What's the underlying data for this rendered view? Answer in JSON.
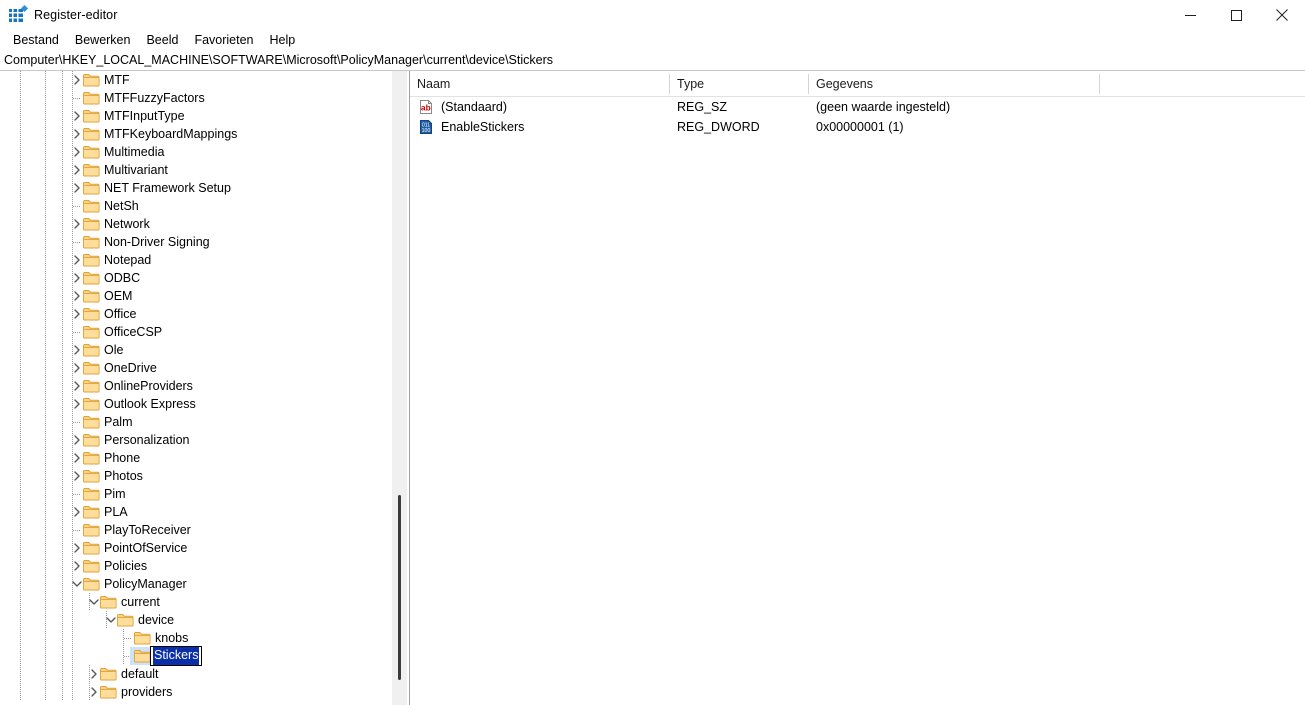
{
  "window": {
    "title": "Register-editor",
    "icon": "registry-editor-icon",
    "controls": {
      "minimize": "minimize-icon",
      "maximize": "maximize-icon",
      "close": "close-icon"
    }
  },
  "menubar": {
    "items": [
      {
        "label": "Bestand"
      },
      {
        "label": "Bewerken"
      },
      {
        "label": "Beeld"
      },
      {
        "label": "Favorieten"
      },
      {
        "label": "Help"
      }
    ]
  },
  "addressbar": {
    "path": "Computer\\HKEY_LOCAL_MACHINE\\SOFTWARE\\Microsoft\\PolicyManager\\current\\device\\Stickers"
  },
  "tree": {
    "scrollbar": {
      "thumb_top_pct": 67,
      "thumb_height_pct": 29
    },
    "nodes": [
      {
        "label": "MTF",
        "depth": 0,
        "expander": "collapsed"
      },
      {
        "label": "MTFFuzzyFactors",
        "depth": 0,
        "expander": "none"
      },
      {
        "label": "MTFInputType",
        "depth": 0,
        "expander": "collapsed"
      },
      {
        "label": "MTFKeyboardMappings",
        "depth": 0,
        "expander": "collapsed"
      },
      {
        "label": "Multimedia",
        "depth": 0,
        "expander": "collapsed"
      },
      {
        "label": "Multivariant",
        "depth": 0,
        "expander": "collapsed"
      },
      {
        "label": "NET Framework Setup",
        "depth": 0,
        "expander": "collapsed"
      },
      {
        "label": "NetSh",
        "depth": 0,
        "expander": "none"
      },
      {
        "label": "Network",
        "depth": 0,
        "expander": "collapsed"
      },
      {
        "label": "Non-Driver Signing",
        "depth": 0,
        "expander": "none"
      },
      {
        "label": "Notepad",
        "depth": 0,
        "expander": "collapsed"
      },
      {
        "label": "ODBC",
        "depth": 0,
        "expander": "collapsed"
      },
      {
        "label": "OEM",
        "depth": 0,
        "expander": "collapsed"
      },
      {
        "label": "Office",
        "depth": 0,
        "expander": "collapsed"
      },
      {
        "label": "OfficeCSP",
        "depth": 0,
        "expander": "none"
      },
      {
        "label": "Ole",
        "depth": 0,
        "expander": "collapsed"
      },
      {
        "label": "OneDrive",
        "depth": 0,
        "expander": "collapsed"
      },
      {
        "label": "OnlineProviders",
        "depth": 0,
        "expander": "collapsed"
      },
      {
        "label": "Outlook Express",
        "depth": 0,
        "expander": "collapsed"
      },
      {
        "label": "Palm",
        "depth": 0,
        "expander": "none"
      },
      {
        "label": "Personalization",
        "depth": 0,
        "expander": "collapsed"
      },
      {
        "label": "Phone",
        "depth": 0,
        "expander": "collapsed"
      },
      {
        "label": "Photos",
        "depth": 0,
        "expander": "collapsed"
      },
      {
        "label": "Pim",
        "depth": 0,
        "expander": "none"
      },
      {
        "label": "PLA",
        "depth": 0,
        "expander": "collapsed"
      },
      {
        "label": "PlayToReceiver",
        "depth": 0,
        "expander": "none"
      },
      {
        "label": "PointOfService",
        "depth": 0,
        "expander": "collapsed"
      },
      {
        "label": "Policies",
        "depth": 0,
        "expander": "collapsed"
      },
      {
        "label": "PolicyManager",
        "depth": 0,
        "expander": "expanded"
      },
      {
        "label": "current",
        "depth": 1,
        "expander": "expanded"
      },
      {
        "label": "device",
        "depth": 2,
        "expander": "expanded"
      },
      {
        "label": "knobs",
        "depth": 3,
        "expander": "none"
      },
      {
        "label": "Stickers",
        "depth": 3,
        "expander": "none",
        "editing": true,
        "selected": true
      },
      {
        "label": "default",
        "depth": 1,
        "expander": "collapsed"
      },
      {
        "label": "providers",
        "depth": 1,
        "expander": "collapsed"
      }
    ]
  },
  "list": {
    "columns": [
      {
        "label": "Naam"
      },
      {
        "label": "Type"
      },
      {
        "label": "Gegevens"
      }
    ],
    "rows": [
      {
        "icon": "string-value-icon",
        "name": "(Standaard)",
        "type": "REG_SZ",
        "data": "(geen waarde ingesteld)"
      },
      {
        "icon": "dword-value-icon",
        "name": "EnableStickers",
        "type": "REG_DWORD",
        "data": "0x00000001 (1)"
      }
    ]
  },
  "colors": {
    "folder": "#ffd27f",
    "folder_edge": "#e8a33d",
    "selection": "#0a2fa8",
    "accent": "#1675c0"
  }
}
